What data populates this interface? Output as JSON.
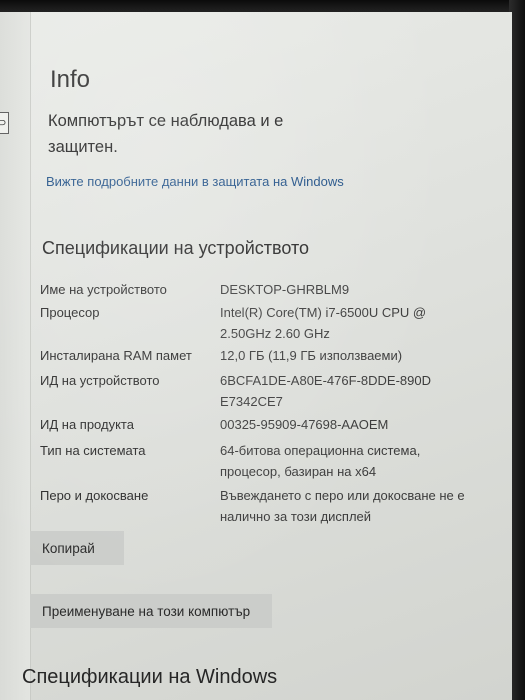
{
  "page": {
    "title": "Info",
    "protection_status": "Компютърът се наблюдава и е защитен.",
    "details_link": "Вижте подробните данни в защитата на Windows"
  },
  "device_specs": {
    "heading": "Спецификации на устройството",
    "rows": [
      {
        "label": "Име на устройството",
        "value": "DESKTOP-GHRBLM9"
      },
      {
        "label": "Процесор",
        "value": "Intel(R) Core(TM) i7-6500U CPU @ 2.50GHz   2.60 GHz"
      },
      {
        "label": "Инсталирана RAM памет",
        "value": "12,0 ГБ (11,9 ГБ използваеми)"
      },
      {
        "label": "ИД на устройството",
        "value": "6BCFA1DE-A80E-476F-8DDE-890DE7342CE7"
      },
      {
        "label": "ИД на продукта",
        "value": "00325-95909-47698-AAOEM"
      },
      {
        "label": "Тип на системата",
        "value": "64-битова операционна система, процесор, базиран на x64"
      },
      {
        "label": "Перо и докосване",
        "value": "Въвеждането с перо или докосване не е налично за този дисплей"
      }
    ]
  },
  "buttons": {
    "copy": "Копирай",
    "rename": "Преименуване на този компютър"
  },
  "windows_specs": {
    "heading": "Спецификации на Windows"
  },
  "edge_icon": {
    "glyph": "⊃",
    "icon": "panel-toggle-icon"
  },
  "colors": {
    "background": "#e3e5e1",
    "link": "#1e4f86",
    "button": "#cbcdca"
  }
}
